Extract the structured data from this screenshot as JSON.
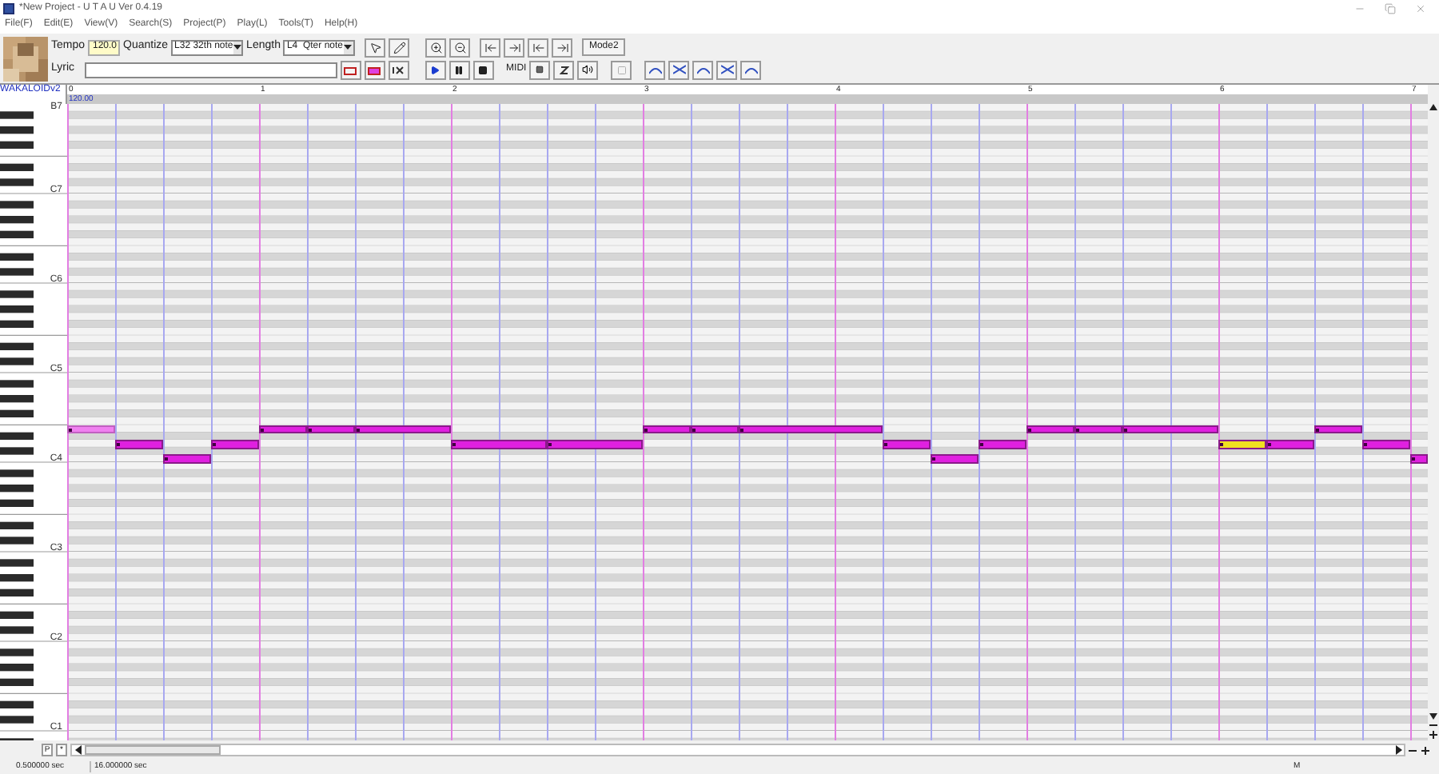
{
  "window": {
    "title": "*New Project - U T A U Ver 0.4.19"
  },
  "menu": [
    "File(F)",
    "Edit(E)",
    "View(V)",
    "Search(S)",
    "Project(P)",
    "Play(L)",
    "Tools(T)",
    "Help(H)"
  ],
  "toolbar": {
    "tempo_label": "Tempo",
    "tempo": "120.0",
    "quantize_label": "Quantize",
    "quantize": "L32 32th note",
    "length_label": "Length",
    "length": "L4  Qter note",
    "mode_button": "Mode2",
    "lyric_label": "Lyric",
    "midi_label": "MIDI"
  },
  "ruler": {
    "singer": "WAKALOIDv2",
    "tempo": "120.00",
    "measures": [
      "0",
      "1",
      "2",
      "3",
      "4",
      "5",
      "6",
      "7"
    ]
  },
  "keyboard": {
    "labels": [
      "B7",
      "C7",
      "C6",
      "C5",
      "C4",
      "C3",
      "C2",
      "C1"
    ]
  },
  "notes": [
    {
      "selected": false,
      "dimmed": true
    },
    {
      "selected": false,
      "dimmed": false
    },
    {
      "selected": false,
      "dimmed": false
    },
    {
      "selected": false,
      "dimmed": false
    },
    {
      "selected": false,
      "dimmed": false
    },
    {
      "selected": false,
      "dimmed": false
    },
    {
      "selected": false,
      "dimmed": false
    },
    {
      "selected": false,
      "dimmed": false
    },
    {
      "selected": false,
      "dimmed": false
    },
    {
      "selected": false,
      "dimmed": false
    },
    {
      "selected": false,
      "dimmed": false
    },
    {
      "selected": false,
      "dimmed": false
    },
    {
      "selected": false,
      "dimmed": false
    },
    {
      "selected": false,
      "dimmed": false
    },
    {
      "selected": false,
      "dimmed": false
    },
    {
      "selected": false,
      "dimmed": false
    },
    {
      "selected": false,
      "dimmed": false
    },
    {
      "selected": false,
      "dimmed": false
    },
    {
      "selected": true,
      "dimmed": false
    },
    {
      "selected": false,
      "dimmed": false
    },
    {
      "selected": false,
      "dimmed": false
    },
    {
      "selected": false,
      "dimmed": false
    },
    {
      "selected": false,
      "dimmed": false
    }
  ],
  "bottom": {
    "part_button": "P",
    "star_button": "*",
    "mode_label": "M"
  },
  "status_bar": [
    "0.500000 sec",
    "16.000000 sec"
  ]
}
